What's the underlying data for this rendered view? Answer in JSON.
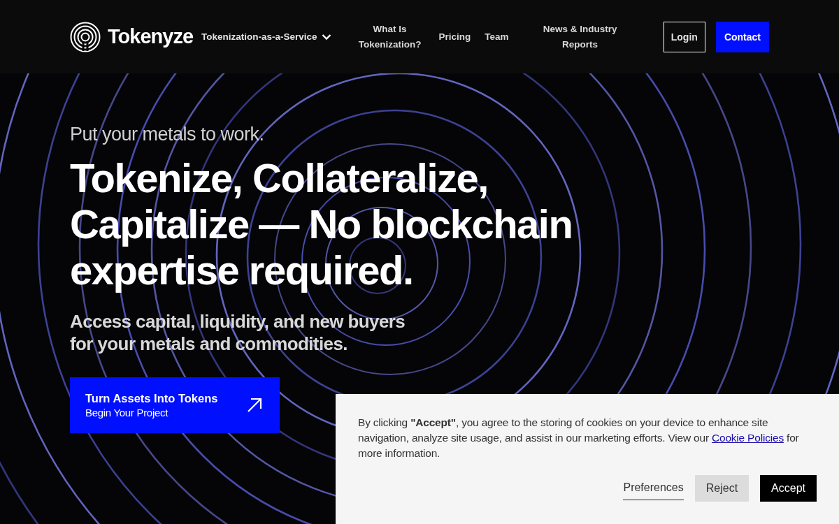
{
  "header": {
    "logo": "Tokenyze",
    "nav": [
      {
        "label": "Tokenization-as-a-Service",
        "kind": "dropdown"
      },
      {
        "label": "What Is Tokenization?",
        "kind": "link"
      },
      {
        "label": "Pricing",
        "kind": "link"
      },
      {
        "label": "Team",
        "kind": "link"
      },
      {
        "label": "News & Industry Reports",
        "kind": "link"
      }
    ],
    "actions": [
      {
        "label": "Login",
        "kind": "outline"
      },
      {
        "label": "Contact",
        "kind": "filled"
      }
    ]
  },
  "hero": {
    "eyebrow": "Put your metals to work.",
    "headline": "Tokenize, Collateralize, Capitalize — No blockchain expertise required.",
    "subhead": "Access capital, liquidity, and new buyers for your metals and commodities.",
    "cta": {
      "title": "Turn Assets Into Tokens",
      "subtitle": "Begin Your Project"
    }
  },
  "cookie_banner": {
    "text": "By clicking **\"Accept\"**, you agree to the storing of cookies on your device to enhance site navigation, analyze site usage, and assist in our marketing efforts. View our",
    "link": "Cookie Policies",
    "text_after": "for more information.",
    "buttons": [
      {
        "label": "Preferences",
        "kind": "underlined"
      },
      {
        "label": "Reject",
        "kind": "secondary"
      },
      {
        "label": "Accept",
        "kind": "primary"
      }
    ]
  }
}
